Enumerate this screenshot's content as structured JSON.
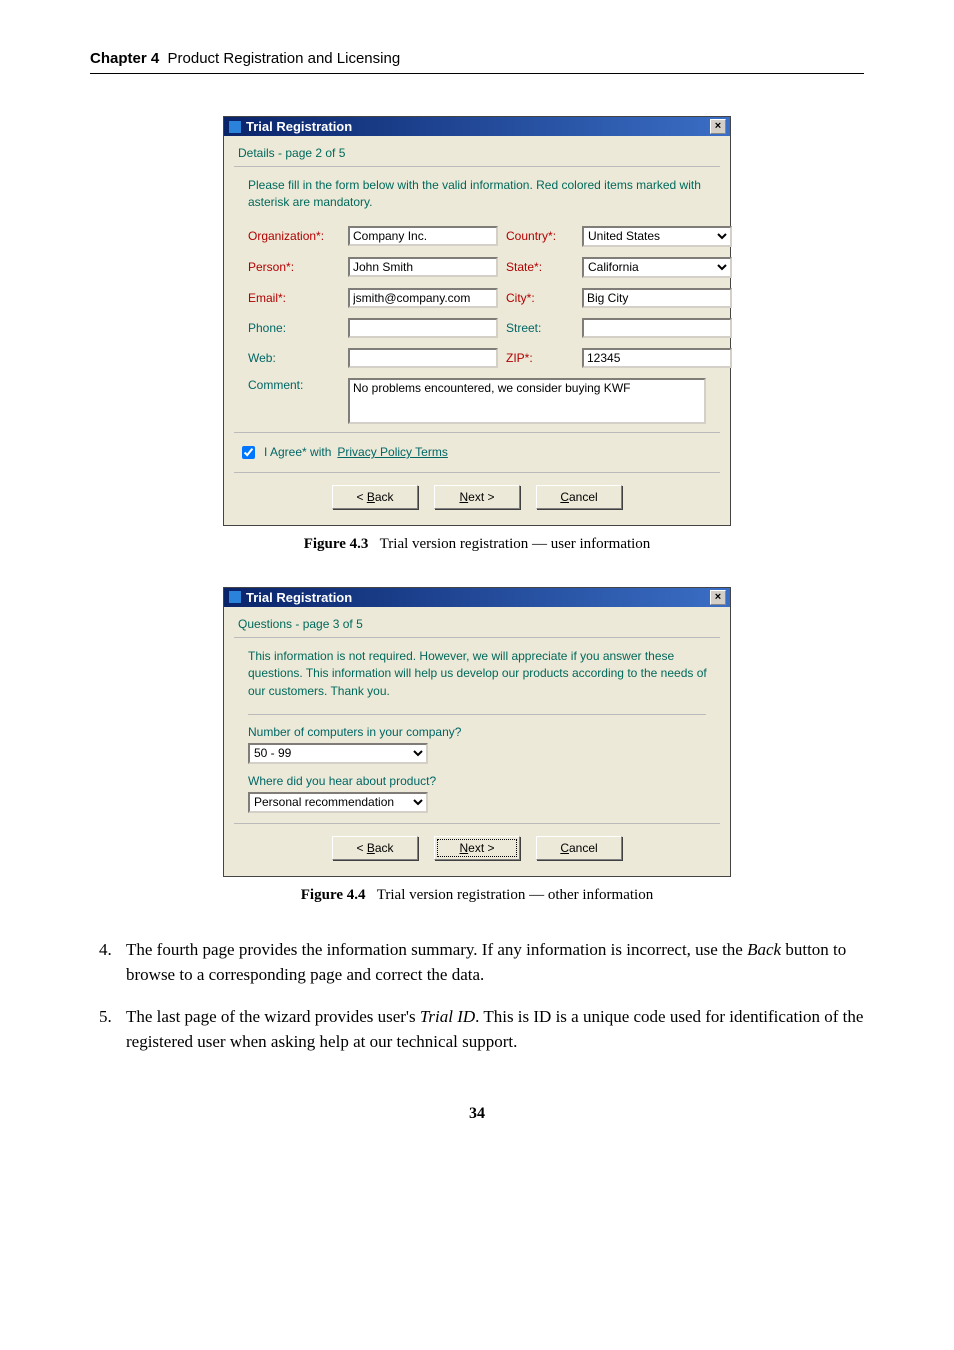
{
  "chapter": {
    "prefix": "Chapter 4",
    "title": "Product Registration and Licensing"
  },
  "dialog1": {
    "title": "Trial Registration",
    "step": "Details - page 2 of 5",
    "instr": "Please fill in the form below with the valid information. Red colored items marked with asterisk are mandatory.",
    "labels": {
      "organization": "Organization*:",
      "country": "Country*:",
      "person": "Person*:",
      "state": "State*:",
      "email": "Email*:",
      "city": "City*:",
      "phone": "Phone:",
      "street": "Street:",
      "web": "Web:",
      "zip": "ZIP*:",
      "comment": "Comment:"
    },
    "values": {
      "organization": "Company Inc.",
      "country": "United States",
      "person": "John Smith",
      "state": "California",
      "email": "jsmith@company.com",
      "city": "Big City",
      "phone": "",
      "street": "",
      "web": "",
      "zip": "12345",
      "comment": "No problems encountered, we consider buying KWF"
    },
    "agree_text": "I Agree* with",
    "agree_link": "Privacy Policy Terms",
    "buttons": {
      "back_b": "B",
      "back_rest": "ack",
      "next_n": "N",
      "next_rest": "ext >",
      "cancel_c": "C",
      "cancel_rest": "ancel"
    }
  },
  "fig1": {
    "label": "Figure 4.3",
    "caption": "Trial version registration — user information"
  },
  "dialog2": {
    "title": "Trial Registration",
    "step": "Questions - page 3 of 5",
    "instr": "This information is not required. However, we will appreciate if you answer these questions. This information will help us develop our products according to the needs of our customers. Thank you.",
    "q1_label": "Number of computers in your company?",
    "q1_value": "50 - 99",
    "q2_label": "Where did you hear about product?",
    "q2_value": "Personal recommendation",
    "buttons": {
      "back_b": "B",
      "back_rest": "ack",
      "next_n": "N",
      "next_rest": "ext >",
      "cancel_c": "C",
      "cancel_rest": "ancel"
    }
  },
  "fig2": {
    "label": "Figure 4.4",
    "caption": "Trial version registration — other information"
  },
  "para4": {
    "part1": "The fourth page provides the information summary. If any information is incorrect, use the ",
    "back_word": "Back",
    "part2": " button to browse to a corresponding page and correct the data."
  },
  "para5": {
    "part1": "The last page of the wizard provides user's ",
    "trial_word": "Trial ID",
    "part2": ". This is ID is a unique code used for identification of the registered user when asking help at our technical support."
  },
  "page_num": "34"
}
